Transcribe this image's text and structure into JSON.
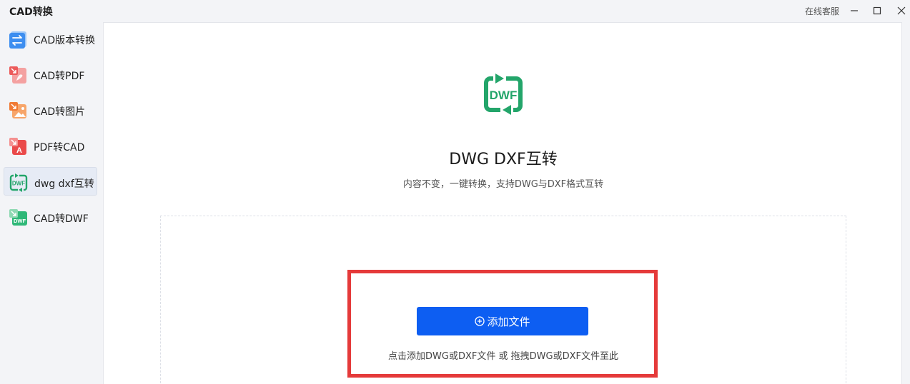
{
  "app": {
    "title": "CAD转换"
  },
  "window": {
    "support_label": "在线客服"
  },
  "sidebar": {
    "items": [
      {
        "label": "CAD版本转换",
        "icon": "version-convert-icon",
        "color": "#3d8ef0",
        "active": false
      },
      {
        "label": "CAD转PDF",
        "icon": "pdf-icon",
        "color": "#ec5b5b",
        "active": false
      },
      {
        "label": "CAD转图片",
        "icon": "image-icon",
        "color": "#f07a34",
        "active": false
      },
      {
        "label": "PDF转CAD",
        "icon": "pdf-to-cad-icon",
        "color": "#ea4a4a",
        "active": false
      },
      {
        "label": "dwg dxf互转",
        "icon": "dwf-icon",
        "color": "#23a56a",
        "active": true
      },
      {
        "label": "CAD转DWF",
        "icon": "cad-dwf-icon",
        "color": "#23a56a",
        "active": false
      }
    ]
  },
  "main": {
    "hero_icon": "dwf-swap-icon",
    "hero_icon_text": "DWF",
    "title": "DWG DXF互转",
    "subtitle": "内容不变，一键转换，支持DWG与DXF格式互转",
    "add_button_label": "添加文件",
    "hint": "点击添加DWG或DXF文件 或 拖拽DWG或DXF文件至此"
  },
  "colors": {
    "primary": "#0d5ef2",
    "highlight": "#e53a3a",
    "green": "#23a56a"
  }
}
